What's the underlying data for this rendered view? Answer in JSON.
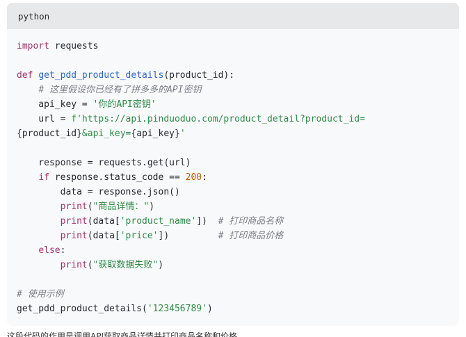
{
  "code_block": {
    "language_label": "python",
    "lines": [
      [
        {
          "t": "kw",
          "v": "import"
        },
        {
          "t": "plain",
          "v": " requests"
        }
      ],
      [],
      [
        {
          "t": "kw",
          "v": "def"
        },
        {
          "t": "plain",
          "v": " "
        },
        {
          "t": "fn",
          "v": "get_pdd_product_details"
        },
        {
          "t": "plain",
          "v": "(product_id):"
        }
      ],
      [
        {
          "t": "plain",
          "v": "    "
        },
        {
          "t": "cm",
          "v": "# 这里假设你已经有了拼多多的API密钥"
        }
      ],
      [
        {
          "t": "plain",
          "v": "    api_key "
        },
        {
          "t": "op",
          "v": "="
        },
        {
          "t": "plain",
          "v": " "
        },
        {
          "t": "str",
          "v": "'你的API密钥'"
        }
      ],
      [
        {
          "t": "plain",
          "v": "    url "
        },
        {
          "t": "op",
          "v": "="
        },
        {
          "t": "plain",
          "v": " "
        },
        {
          "t": "str",
          "v": "f'https://api.pinduoduo.com/product_detail?product_id="
        }
      ],
      [
        {
          "t": "plain",
          "v": "{product_id}"
        },
        {
          "t": "str",
          "v": "&api_key="
        },
        {
          "t": "plain",
          "v": "{api_key}"
        },
        {
          "t": "str",
          "v": "'"
        }
      ],
      [],
      [
        {
          "t": "plain",
          "v": "    response "
        },
        {
          "t": "op",
          "v": "="
        },
        {
          "t": "plain",
          "v": " requests.get(url)"
        }
      ],
      [
        {
          "t": "plain",
          "v": "    "
        },
        {
          "t": "kw",
          "v": "if"
        },
        {
          "t": "plain",
          "v": " response.status_code "
        },
        {
          "t": "op",
          "v": "=="
        },
        {
          "t": "plain",
          "v": " "
        },
        {
          "t": "num",
          "v": "200"
        },
        {
          "t": "plain",
          "v": ":"
        }
      ],
      [
        {
          "t": "plain",
          "v": "        data "
        },
        {
          "t": "op",
          "v": "="
        },
        {
          "t": "plain",
          "v": " response.json()"
        }
      ],
      [
        {
          "t": "plain",
          "v": "        "
        },
        {
          "t": "bi",
          "v": "print"
        },
        {
          "t": "plain",
          "v": "("
        },
        {
          "t": "str",
          "v": "\"商品详情：\""
        },
        {
          "t": "plain",
          "v": ")"
        }
      ],
      [
        {
          "t": "plain",
          "v": "        "
        },
        {
          "t": "bi",
          "v": "print"
        },
        {
          "t": "plain",
          "v": "(data["
        },
        {
          "t": "str",
          "v": "'product_name'"
        },
        {
          "t": "plain",
          "v": "])  "
        },
        {
          "t": "cm",
          "v": "# 打印商品名称"
        }
      ],
      [
        {
          "t": "plain",
          "v": "        "
        },
        {
          "t": "bi",
          "v": "print"
        },
        {
          "t": "plain",
          "v": "(data["
        },
        {
          "t": "str",
          "v": "'price'"
        },
        {
          "t": "plain",
          "v": "])         "
        },
        {
          "t": "cm",
          "v": "# 打印商品价格"
        }
      ],
      [
        {
          "t": "plain",
          "v": "    "
        },
        {
          "t": "kw",
          "v": "else"
        },
        {
          "t": "plain",
          "v": ":"
        }
      ],
      [
        {
          "t": "plain",
          "v": "        "
        },
        {
          "t": "bi",
          "v": "print"
        },
        {
          "t": "plain",
          "v": "("
        },
        {
          "t": "str",
          "v": "\"获取数据失败\""
        },
        {
          "t": "plain",
          "v": ")"
        }
      ],
      [],
      [
        {
          "t": "cm",
          "v": "# 使用示例"
        }
      ],
      [
        {
          "t": "plain",
          "v": "get_pdd_product_details("
        },
        {
          "t": "str",
          "v": "'123456789'"
        },
        {
          "t": "plain",
          "v": ")"
        }
      ]
    ]
  },
  "cutoff_text": "这段代码的作用是调用API获取商品详情并打印商品名称和价格"
}
